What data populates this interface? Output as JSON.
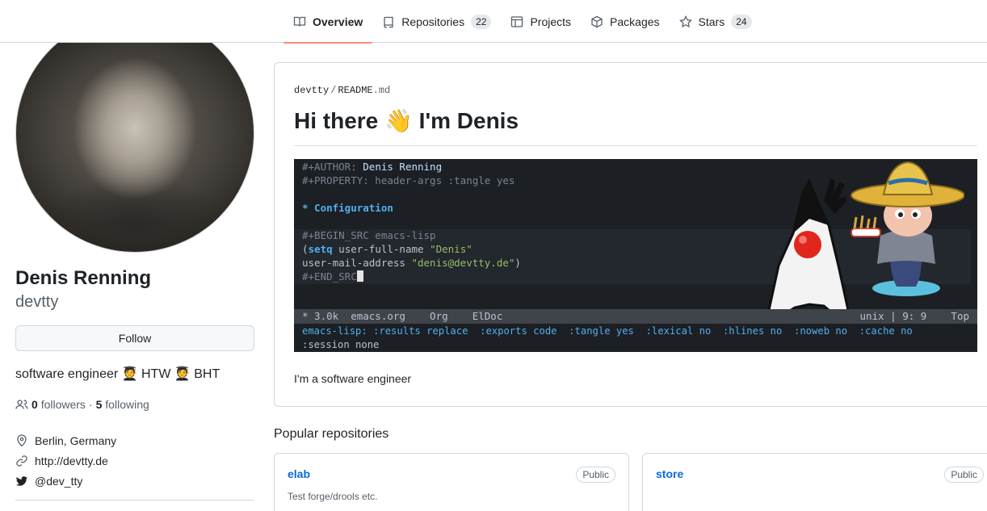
{
  "nav": {
    "tabs": [
      {
        "label": "Overview",
        "icon": "book-icon",
        "active": true
      },
      {
        "label": "Repositories",
        "count": "22",
        "icon": "repo-icon"
      },
      {
        "label": "Projects",
        "icon": "table-icon"
      },
      {
        "label": "Packages",
        "icon": "package-icon"
      },
      {
        "label": "Stars",
        "count": "24",
        "icon": "star-icon"
      }
    ]
  },
  "profile": {
    "name": "Denis Renning",
    "login": "devtty",
    "follow_label": "Follow",
    "bio": "software engineer 🧑‍🎓 HTW 🧑‍🎓 BHT",
    "followers_count": "0",
    "followers_label": "followers",
    "separator": "·",
    "following_count": "5",
    "following_label": "following",
    "location": "Berlin, Germany",
    "website": "http://devtty.de",
    "twitter": "@dev_tty"
  },
  "readme": {
    "owner": "devtty",
    "path_sep": "/",
    "file": "README",
    "ext": ".md",
    "heading": "Hi there 👋 I'm Denis",
    "paragraph": "I'm a software engineer",
    "terminal": {
      "l1_key": "#+AUTHOR: ",
      "l1_val": "Denis Renning",
      "l2": "#+PROPERTY: header-args :tangle yes",
      "l3": "* Configuration",
      "l4": "#+BEGIN_SRC emacs-lisp",
      "l5_open": "(",
      "l5_kw": "setq",
      "l5_var": " user-full-name ",
      "l5_str": "\"Denis\"",
      "l6_var": "user-mail-address ",
      "l6_str": "\"denis@devtty.de\"",
      "l6_close": ")",
      "l7": "#+END_SRC",
      "modeline_left": "* 3.0k  emacs.org    Org    ElDoc",
      "modeline_right": "unix | 9: 9    Top",
      "echo1": "emacs-lisp: :results replace  :exports code  :tangle yes  :lexical no  :hlines no  :noweb no  :cache no",
      "echo2": ":session none"
    }
  },
  "popular": {
    "title": "Popular repositories",
    "repos": [
      {
        "name": "elab",
        "visibility": "Public",
        "description": "Test forge/drools etc."
      },
      {
        "name": "store",
        "visibility": "Public",
        "description": ""
      }
    ]
  },
  "colors": {
    "accent_underline": "#fd8c73",
    "link": "#0969da",
    "terminal_bg": "#1c1f24"
  }
}
